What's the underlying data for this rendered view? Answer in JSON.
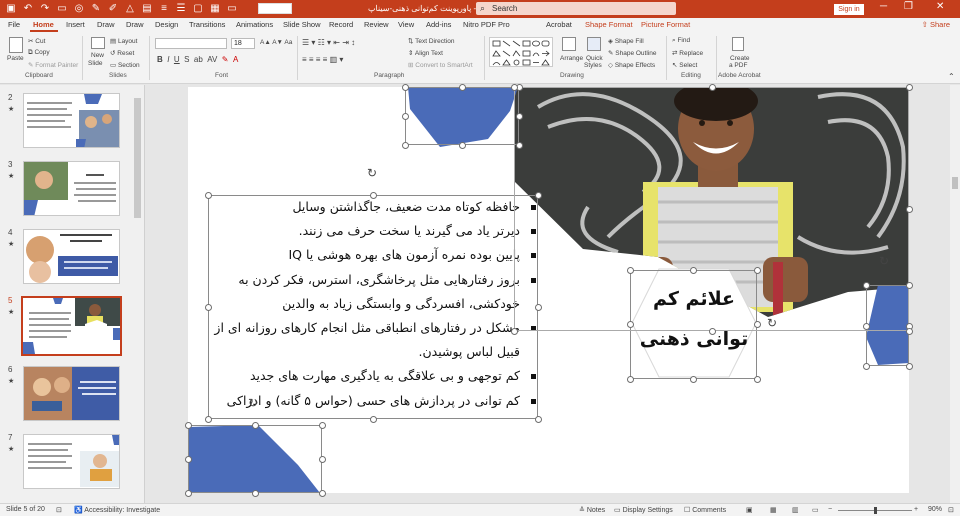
{
  "titlebar": {
    "doc_title": "پاورپوینت کم‌توانی ذهنی-سیناپ‌ - PowerPoint",
    "search_placeholder": "Search",
    "signin_label": "Sign in",
    "minimize": "─",
    "restore": "❐",
    "close": "✕"
  },
  "tabs": [
    {
      "label": "File"
    },
    {
      "label": "Home"
    },
    {
      "label": "Insert"
    },
    {
      "label": "Draw"
    },
    {
      "label": "Draw"
    },
    {
      "label": "Design"
    },
    {
      "label": "Transitions"
    },
    {
      "label": "Animations"
    },
    {
      "label": "Slide Show"
    },
    {
      "label": "Record"
    },
    {
      "label": "Review"
    },
    {
      "label": "View"
    },
    {
      "label": "Add-ins"
    },
    {
      "label": "Nitro PDF Pro"
    },
    {
      "label": "Acrobat"
    },
    {
      "label": "Shape Format"
    },
    {
      "label": "Picture Format"
    }
  ],
  "share_label": "Share",
  "ribbon": {
    "paste": "Paste",
    "cut": "Cut",
    "copy": "Copy",
    "format_painter": "Format Painter",
    "new_slide": "New",
    "new_slide2": "Slide",
    "layout": "Layout",
    "reset": "Reset",
    "section": "Section",
    "font_size": "18",
    "text_direction": "Text Direction",
    "align_text": "Align Text",
    "convert_smartart": "Convert to SmartArt",
    "arrange": "Arrange",
    "quick_styles": "Quick",
    "quick_styles2": "Styles",
    "shape_fill": "Shape Fill",
    "shape_outline": "Shape Outline",
    "shape_effects": "Shape Effects",
    "find": "Find",
    "replace": "Replace",
    "select": "Select",
    "create_pdf": "Create",
    "create_pdf2": "a PDF",
    "groups": {
      "clipboard": "Clipboard",
      "slides": "Slides",
      "font": "Font",
      "paragraph": "Paragraph",
      "drawing": "Drawing",
      "editing": "Editing",
      "adobe": "Adobe Acrobat"
    }
  },
  "thumbnails": [
    {
      "num": "2",
      "star": "★"
    },
    {
      "num": "3",
      "star": "★"
    },
    {
      "num": "4",
      "star": "★"
    },
    {
      "num": "5",
      "star": "★"
    },
    {
      "num": "6",
      "star": "★"
    },
    {
      "num": "7",
      "star": "★"
    }
  ],
  "slide": {
    "title_line1": "علائم کم",
    "title_line2": "توانی ذهنی",
    "bullets": [
      "حافظه کوتاه مدت ضعیف، جاگذاشتن وسایل",
      "دیرتر یاد می گیرند یا سخت حرف می زنند.",
      "پایین بوده نمره آزمون های بهره هوشی یا IQ",
      "بروز رفتارهایی مثل پرخاشگری، استرس، فکر کردن به خودکشی، افسردگی و وابستگی زیاد به والدین",
      "مشکل در رفتارهای انطباقی مثل انجام کارهای روزانه ای از قبیل لباس پوشیدن.",
      "کم توجهی و بی علاقگی به یادگیری مهارت های جدید",
      "کم توانی در پردازش های حسی (حواس ۵ گانه) و ادراکی"
    ]
  },
  "status": {
    "slide_count": "Slide 5 of 20",
    "accessibility": "Accessibility: Investigate",
    "notes": "Notes",
    "display_settings": "Display Settings",
    "comments": "Comments",
    "zoom": "90%"
  },
  "colors": {
    "accent": "#c43e1c",
    "shape_blue": "#4a6bb8"
  }
}
